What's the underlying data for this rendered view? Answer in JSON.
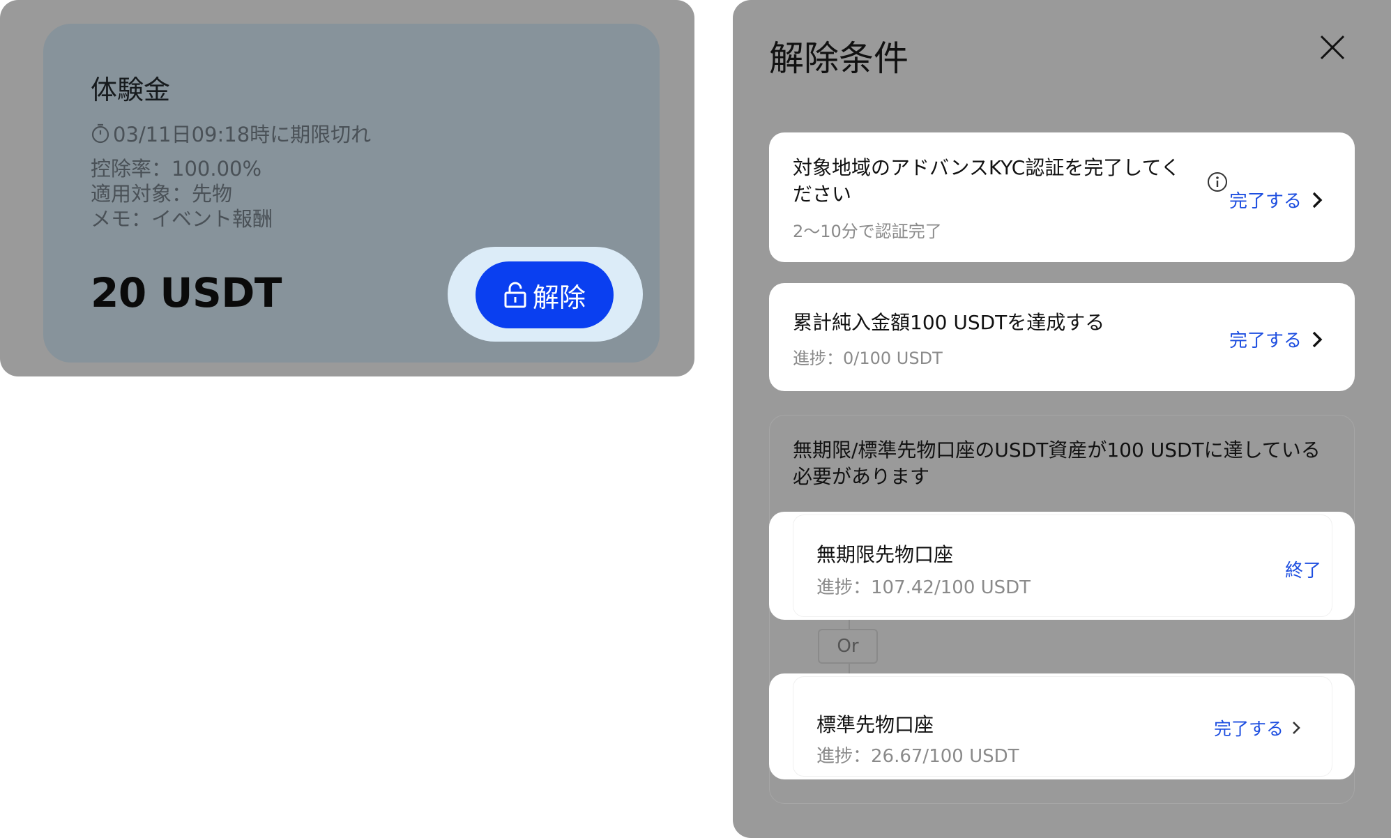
{
  "bonus_card": {
    "title": "体験金",
    "expiry": "03/11日09:18時に期限切れ",
    "deduction_rate": "控除率：100.00%",
    "applicable": "適用対象：先物",
    "memo": "メモ：イベント報酬",
    "amount": "20 USDT",
    "unlock_label": "解除",
    "icons": {
      "expiry": "timer-icon",
      "unlock": "unlock-icon"
    }
  },
  "conditions_panel": {
    "title": "解除条件",
    "close_icon": "close-icon",
    "conditions": [
      {
        "title": "対象地域のアドバンスKYC認証を完了してください",
        "title_line1": "対象地域のアドバンスKYC認証を完了してく",
        "title_line2": "ださい",
        "subtitle": "2〜10分で認証完了",
        "action": "完了する"
      },
      {
        "title": "累計純入金額100 USDTを達成する",
        "subtitle": "進捗：0/100 USDT",
        "action": "完了する"
      }
    ],
    "group": {
      "title": "無期限/標準先物口座のUSDT資産が100 USDTに達している必要があります",
      "accounts": [
        {
          "name": "無期限先物口座",
          "progress": "進捗：107.42/100 USDT",
          "status": "終了"
        },
        {
          "name": "標準先物口座",
          "progress": "進捗：26.67/100 USDT",
          "status": "完了する"
        }
      ],
      "separator": "Or"
    }
  },
  "colors": {
    "overlay": "#9a9a9a",
    "card_bg": "#87939b",
    "primary": "#0a3ff0",
    "link": "#1d4ee0",
    "halo": "#dcecf8"
  }
}
